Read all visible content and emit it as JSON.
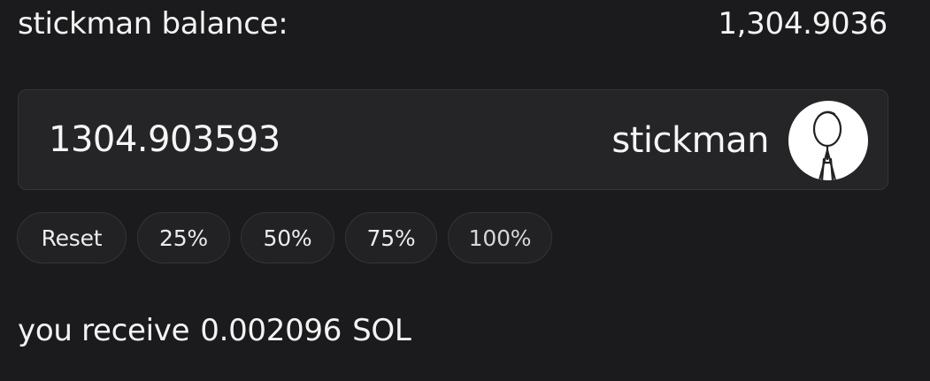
{
  "balance": {
    "label": "stickman balance:",
    "value": "1,304.9036"
  },
  "amount_input": {
    "value": "1304.903593"
  },
  "token": {
    "name": "stickman",
    "icon": "stickman-avatar-icon"
  },
  "percent_buttons": [
    {
      "label": "Reset"
    },
    {
      "label": "25%"
    },
    {
      "label": "50%"
    },
    {
      "label": "75%"
    },
    {
      "label": "100%"
    }
  ],
  "receive": {
    "prefix": "you receive",
    "amount": "0.002096",
    "unit": "SOL"
  },
  "colors": {
    "background": "#1b1b1d",
    "panel": "#252527",
    "border": "#343437",
    "text": "#f3f3f3"
  }
}
